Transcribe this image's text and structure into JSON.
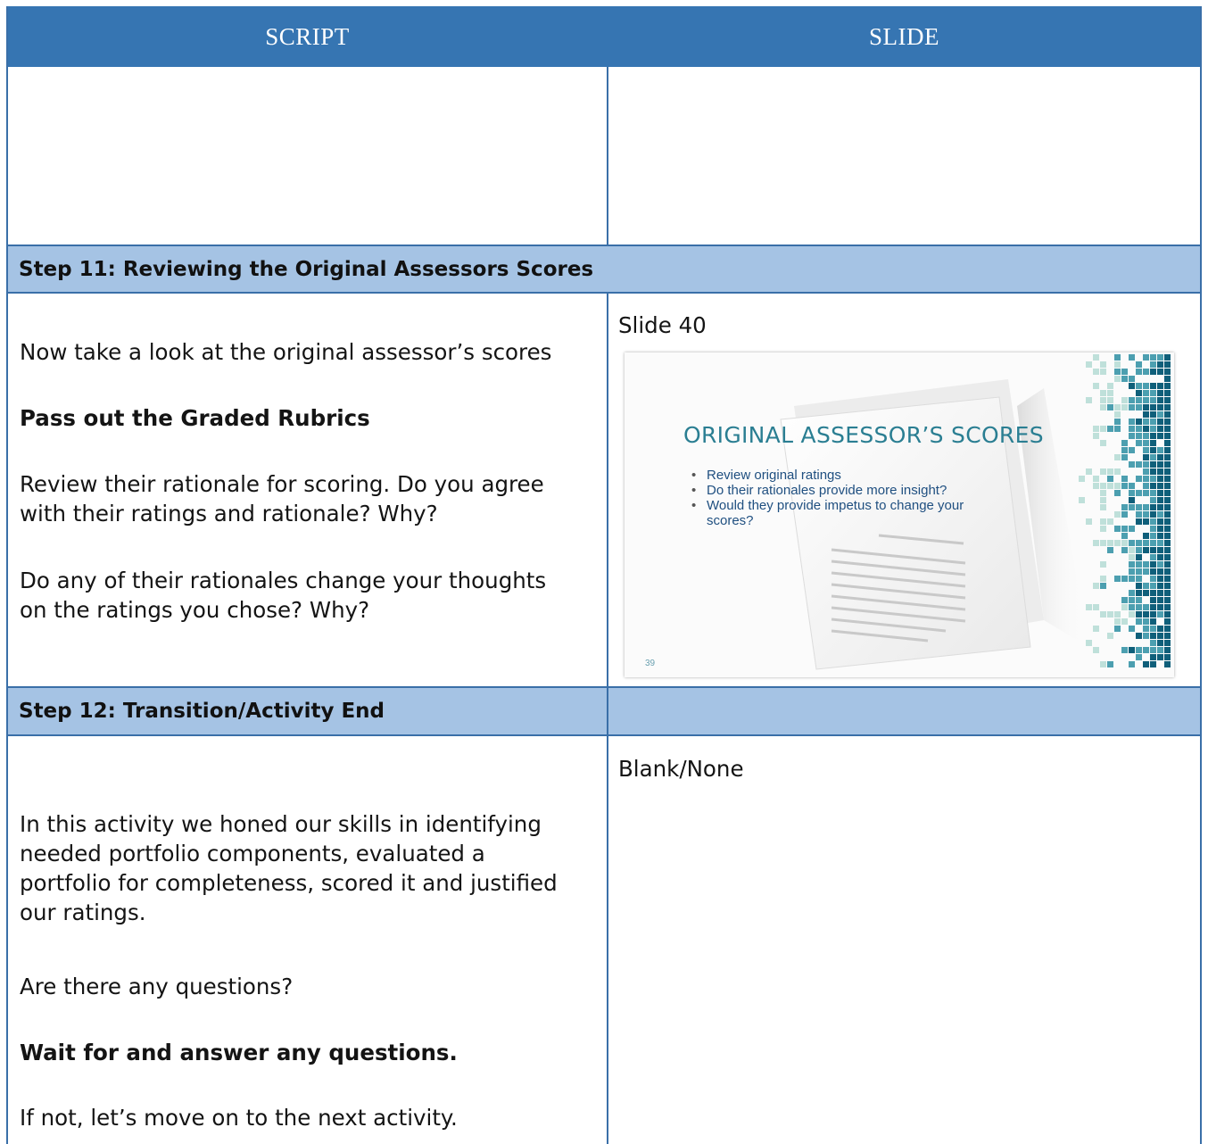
{
  "header": {
    "script_label": "SCRIPT",
    "slide_label": "SLIDE"
  },
  "step11": {
    "title": "Step 11: Reviewing the Original Assessors Scores",
    "script": {
      "p1": "Now take a look at the original assessor’s scores",
      "p2": "Pass out the Graded Rubrics",
      "p3_line1": "Review their rationale for scoring. Do you agree",
      "p3_line2": "with their ratings and rationale? Why?",
      "p4_line1": "Do any of their rationales change your thoughts",
      "p4_line2": "on the ratings you chose? Why?"
    },
    "slide": {
      "label": "Slide 40",
      "thumb_title": "ORIGINAL ASSESSOR’S SCORES",
      "bullets": [
        "Review original ratings",
        "Do their rationales provide more insight?",
        "Would they provide impetus to change your scores?"
      ],
      "page_number": "39",
      "colors": {
        "title": "#2a7e92",
        "bullets": "#1f4f80",
        "mosaic_dark": "#0f5f7a",
        "mosaic_mid": "#4c9fb0",
        "mosaic_light": "#bfe0da"
      }
    }
  },
  "step12": {
    "title": "Step 12: Transition/Activity End",
    "script": {
      "p1_line1": "In this activity we honed our skills in identifying",
      "p1_line2": "needed portfolio components, evaluated a",
      "p1_line3": "portfolio for completeness, scored it and justified",
      "p1_line4": "our ratings.",
      "p2": "Are there any questions?",
      "p3": "Wait for and answer any questions.",
      "p4": "If not, let’s move on to the next activity."
    },
    "slide": {
      "label": "Blank/None"
    }
  },
  "colors": {
    "header_bg": "#3675b2",
    "step_bg": "#a5c3e4",
    "border": "#3a6fa8"
  }
}
